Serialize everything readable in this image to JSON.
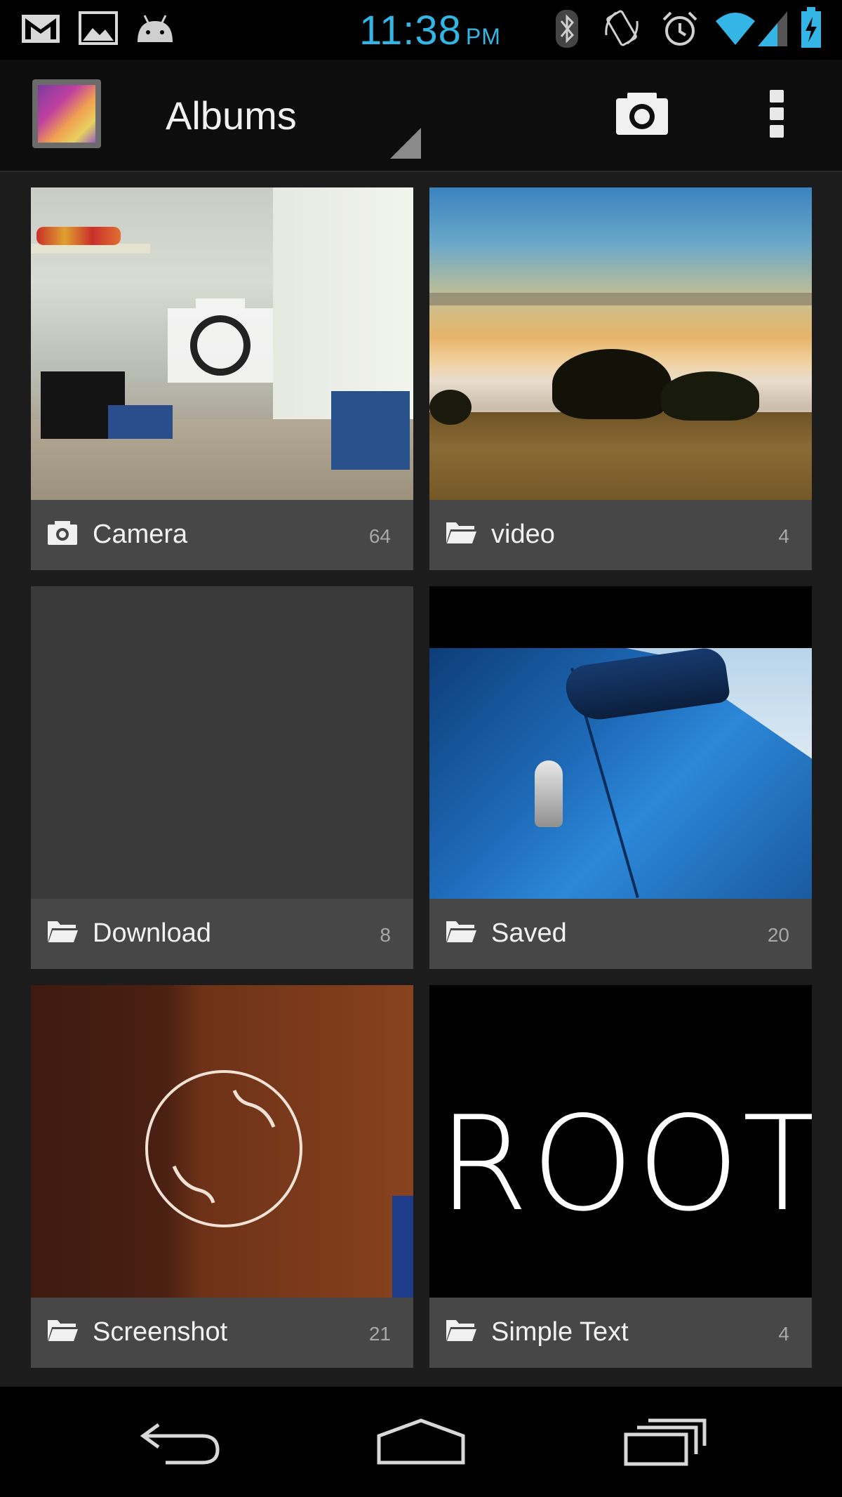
{
  "status_bar": {
    "time": "11:38",
    "ampm": "PM",
    "left_icons": [
      "gmail-icon",
      "gallery-notification-icon",
      "android-debug-icon"
    ],
    "right_icons": [
      "bluetooth-icon",
      "rotation-icon",
      "alarm-icon",
      "wifi-icon",
      "signal-icon",
      "battery-icon"
    ]
  },
  "action_bar": {
    "title": "Albums",
    "actions": [
      "camera-icon",
      "overflow-menu-icon"
    ]
  },
  "albums": [
    {
      "name": "Camera",
      "count": "64",
      "icon": "camera-icon"
    },
    {
      "name": "video",
      "count": "4",
      "icon": "folder-icon"
    },
    {
      "name": "Download",
      "count": "8",
      "icon": "folder-icon"
    },
    {
      "name": "Saved",
      "count": "20",
      "icon": "folder-icon"
    },
    {
      "name": "Screenshot",
      "count": "21",
      "icon": "folder-icon"
    },
    {
      "name": "Simple Text",
      "count": "4",
      "icon": "folder-icon"
    }
  ],
  "thumb_text": {
    "root": "ROOT"
  },
  "nav_bar": [
    "back-icon",
    "home-icon",
    "recents-icon"
  ],
  "colors": {
    "accent": "#33b5e5",
    "background": "#1c1c1c",
    "caption": "#474747"
  }
}
